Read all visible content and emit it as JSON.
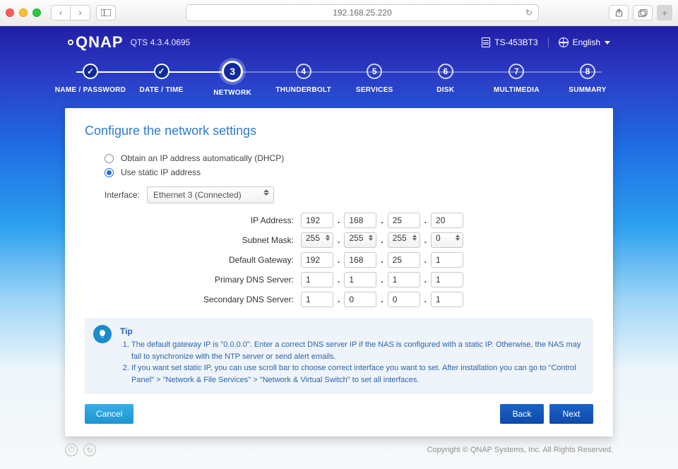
{
  "browser": {
    "url": "192.168.25.220"
  },
  "header": {
    "brand": "QNAP",
    "firmware": "QTS 4.3.4.0695",
    "model": "TS-453BT3",
    "language": "English"
  },
  "stepper": {
    "steps": [
      {
        "label": "NAME / PASSWORD",
        "state": "done"
      },
      {
        "label": "DATE / TIME",
        "state": "done"
      },
      {
        "label": "NETWORK",
        "state": "current",
        "num": "3"
      },
      {
        "label": "THUNDERBOLT",
        "state": "todo",
        "num": "4"
      },
      {
        "label": "SERVICES",
        "state": "todo",
        "num": "5"
      },
      {
        "label": "DISK",
        "state": "todo",
        "num": "6"
      },
      {
        "label": "MULTIMEDIA",
        "state": "todo",
        "num": "7"
      },
      {
        "label": "SUMMARY",
        "state": "todo",
        "num": "8"
      }
    ]
  },
  "card": {
    "title": "Configure the network settings",
    "radio_dhcp": "Obtain an IP address automatically (DHCP)",
    "radio_static": "Use static IP address",
    "selected_mode": "static",
    "interface_label": "Interface:",
    "interface_value": "Ethernet 3 (Connected)",
    "rows": {
      "ip": {
        "label": "IP Address:",
        "oct": [
          "192",
          "168",
          "25",
          "20"
        ],
        "type": "text"
      },
      "mask": {
        "label": "Subnet Mask:",
        "oct": [
          "255",
          "255",
          "255",
          "0"
        ],
        "type": "select"
      },
      "gateway": {
        "label": "Default Gateway:",
        "oct": [
          "192",
          "168",
          "25",
          "1"
        ],
        "type": "text"
      },
      "dns1": {
        "label": "Primary DNS Server:",
        "oct": [
          "1",
          "1",
          "1",
          "1"
        ],
        "type": "text"
      },
      "dns2": {
        "label": "Secondary DNS Server:",
        "oct": [
          "1",
          "0",
          "0",
          "1"
        ],
        "type": "text"
      }
    },
    "tip": {
      "heading": "Tip",
      "item1": "The default gateway IP is \"0.0.0.0\". Enter a correct DNS server IP if the NAS is configured with a static IP. Otherwise, the NAS may fail to synchronize with the NTP server or send alert emails.",
      "item2": "If you want set static IP, you can use scroll bar to choose correct interface you want to set. After installation you can go to \"Control Panel\" > \"Network & File Services\" > \"Network & Virtual Switch\" to set all interfaces."
    },
    "buttons": {
      "cancel": "Cancel",
      "back": "Back",
      "next": "Next"
    }
  },
  "footer": {
    "copyright": "Copyright © QNAP Systems, Inc. All Rights Reserved."
  }
}
